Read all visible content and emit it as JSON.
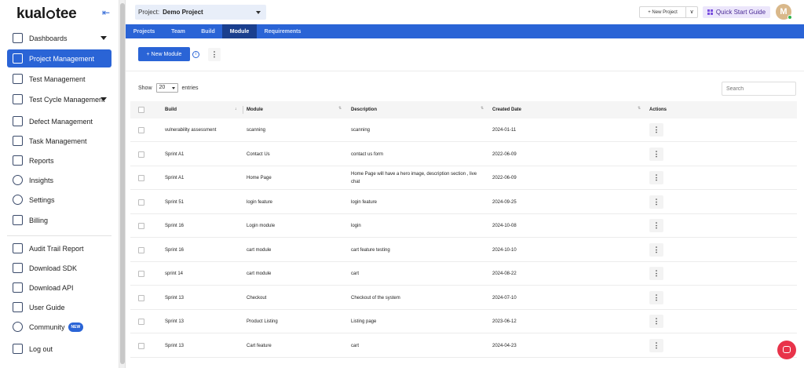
{
  "app": {
    "logo": "kualitee"
  },
  "sidebar": {
    "items": [
      {
        "label": "Dashboards",
        "icon": "dashboard-icon",
        "has_caret": true
      },
      {
        "label": "Project Management",
        "icon": "project-management-icon",
        "active": true
      },
      {
        "label": "Test Management",
        "icon": "test-management-icon"
      },
      {
        "label": "Test Cycle Management",
        "icon": "test-cycle-icon",
        "has_caret": true
      },
      {
        "label": "Defect Management",
        "icon": "defect-icon"
      },
      {
        "label": "Task Management",
        "icon": "task-icon"
      },
      {
        "label": "Reports",
        "icon": "reports-icon"
      },
      {
        "label": "Insights",
        "icon": "insights-icon"
      },
      {
        "label": "Settings",
        "icon": "settings-icon"
      },
      {
        "label": "Billing",
        "icon": "billing-icon"
      }
    ],
    "bottom_items": [
      {
        "label": "Audit Trail Report",
        "icon": "audit-icon"
      },
      {
        "label": "Download SDK",
        "icon": "sdk-icon"
      },
      {
        "label": "Download API",
        "icon": "api-icon"
      },
      {
        "label": "User Guide",
        "icon": "guide-icon"
      },
      {
        "label": "Community",
        "icon": "community-icon",
        "badge": "NEW"
      },
      {
        "label": "Log out",
        "icon": "logout-icon"
      }
    ]
  },
  "header": {
    "project_label": "Project:",
    "project_value": "Demo Project",
    "new_project": "+ New Project",
    "new_project_drop": "∨",
    "quick_start": "Quick Start Guide",
    "avatar_initial": "M"
  },
  "tabs": [
    {
      "label": "Projects"
    },
    {
      "label": "Team"
    },
    {
      "label": "Build"
    },
    {
      "label": "Module",
      "active": true
    },
    {
      "label": "Requirements"
    }
  ],
  "toolbar": {
    "new_module": "+ New Module",
    "info": "i",
    "kebab": "⋮"
  },
  "list_controls": {
    "show_label": "Show",
    "entries_value": "20",
    "entries_label": "entries",
    "search_placeholder": "Search"
  },
  "table": {
    "headers": [
      "Build",
      "Module",
      "Description",
      "Created Date",
      "Actions"
    ],
    "action_label": "⋮",
    "rows": [
      {
        "build": "vulnerability assessment",
        "module": "scanning",
        "description": "scanning",
        "created": "2024-01-11"
      },
      {
        "build": "Sprint A1",
        "module": "Contact Us",
        "description": "contact us form",
        "created": "2022-06-09"
      },
      {
        "build": "Sprint A1",
        "module": "Home Page",
        "description": "Home Page will have a hero image, description section , live chat",
        "created": "2022-06-09"
      },
      {
        "build": "Sprint 51",
        "module": "login feature",
        "description": "login feature",
        "created": "2024-09-25"
      },
      {
        "build": "Sprint 16",
        "module": "Login module",
        "description": "login",
        "created": "2024-10-08"
      },
      {
        "build": "Sprint 16",
        "module": "cart module",
        "description": "cart feature testing",
        "created": "2024-10-10"
      },
      {
        "build": "sprint 14",
        "module": "cart module",
        "description": "cart",
        "created": "2024-08-22"
      },
      {
        "build": "Sprint 13",
        "module": "Checkout",
        "description": "Checkout of the system",
        "created": "2024-07-10"
      },
      {
        "build": "Sprint 13",
        "module": "Product Listing",
        "description": "Listing page",
        "created": "2023-06-12"
      },
      {
        "build": "Sprint 13",
        "module": "Cart feature",
        "description": "cart",
        "created": "2024-04-23"
      }
    ]
  }
}
